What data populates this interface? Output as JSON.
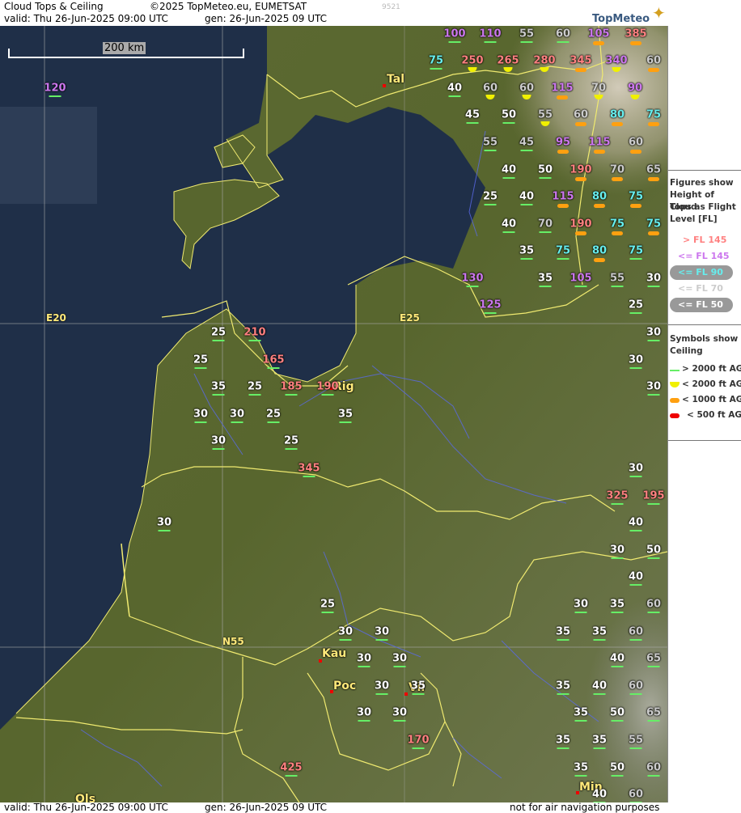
{
  "header": {
    "title": "Cloud Tops & Ceiling",
    "copyright": "©2025 TopMeteo.eu, EUMETSAT",
    "code": "9521",
    "valid": "valid:  Thu  26-Jun-2025  09:00 UTC",
    "gen": "gen: 26-Jun-2025 09 UTC",
    "logo": "TopMeteo"
  },
  "footer": {
    "valid": "valid:  Thu  26-Jun-2025  09:00 UTC",
    "gen": "gen: 26-Jun-2025 09 UTC",
    "disclaimer": "not for air navigation purposes"
  },
  "map": {
    "scale_label": "200 km",
    "coords": {
      "e20": "E20",
      "e25": "E25",
      "n55": "N55"
    },
    "cities": [
      "Tal",
      "Rig",
      "Kau",
      "Poc",
      "Vil",
      "Min",
      "Ols"
    ],
    "colors": {
      "pink": "#ff8080",
      "violet": "#cc77ee",
      "cyan": "#66eeee",
      "grey": "#cccccc",
      "white": "#ffffff",
      "sym_green": "#66ee66",
      "sym_yellow": "#f0f000",
      "sym_orange": "#ffa010",
      "sym_red": "#ee0000"
    },
    "cloud_labels": [
      [
        "100",
        "violet",
        "green"
      ],
      [
        "110",
        "violet",
        "green"
      ],
      [
        "55",
        "grey",
        "green"
      ],
      [
        "60",
        "grey",
        "green"
      ],
      [
        "105",
        "violet",
        "orange"
      ],
      [
        "385",
        "pink",
        "orange"
      ],
      [
        "120",
        "violet",
        "green"
      ],
      [
        "75",
        "cyan",
        "green"
      ],
      [
        "250",
        "pink",
        "yellow"
      ],
      [
        "265",
        "pink",
        "yellow"
      ],
      [
        "280",
        "pink",
        "yellow"
      ],
      [
        "345",
        "pink",
        "orange"
      ],
      [
        "340",
        "violet",
        "yellow"
      ],
      [
        "60",
        "grey",
        "orange"
      ],
      [
        "40",
        "white",
        "green"
      ],
      [
        "60",
        "grey",
        "yellow"
      ],
      [
        "60",
        "grey",
        "yellow"
      ],
      [
        "115",
        "violet",
        "orange"
      ],
      [
        "70",
        "grey",
        "yellow"
      ],
      [
        "90",
        "violet",
        "yellow"
      ],
      [
        "45",
        "white",
        "green"
      ],
      [
        "50",
        "white",
        "green"
      ],
      [
        "55",
        "grey",
        "yellow"
      ],
      [
        "60",
        "grey",
        "orange"
      ],
      [
        "80",
        "cyan",
        "orange"
      ],
      [
        "75",
        "cyan",
        "orange"
      ],
      [
        "55",
        "grey",
        "green"
      ],
      [
        "45",
        "grey",
        "green"
      ],
      [
        "95",
        "violet",
        "orange"
      ],
      [
        "115",
        "violet",
        "orange"
      ],
      [
        "60",
        "grey",
        "orange"
      ],
      [
        "40",
        "white",
        "green"
      ],
      [
        "50",
        "white",
        "green"
      ],
      [
        "190",
        "pink",
        "orange"
      ],
      [
        "70",
        "grey",
        "orange"
      ],
      [
        "65",
        "grey",
        "orange"
      ],
      [
        "25",
        "white",
        "green"
      ],
      [
        "40",
        "white",
        "green"
      ],
      [
        "115",
        "violet",
        "orange"
      ],
      [
        "80",
        "cyan",
        "orange"
      ],
      [
        "75",
        "cyan",
        "orange"
      ],
      [
        "40",
        "white",
        "green"
      ],
      [
        "70",
        "grey",
        "green"
      ],
      [
        "190",
        "pink",
        "orange"
      ],
      [
        "75",
        "cyan",
        "orange"
      ],
      [
        "75",
        "cyan",
        "orange"
      ],
      [
        "35",
        "white",
        "green"
      ],
      [
        "75",
        "cyan",
        "green"
      ],
      [
        "80",
        "cyan",
        "orange"
      ],
      [
        "75",
        "cyan",
        "green"
      ],
      [
        "130",
        "violet",
        "green"
      ],
      [
        "35",
        "white",
        "green"
      ],
      [
        "105",
        "violet",
        "green"
      ],
      [
        "55",
        "grey",
        "green"
      ],
      [
        "30",
        "white",
        "green"
      ],
      [
        "125",
        "violet",
        "green"
      ],
      [
        "25",
        "white",
        "green"
      ],
      [
        "25",
        "white",
        "green"
      ],
      [
        "210",
        "pink",
        "green"
      ],
      [
        "30",
        "white",
        "green"
      ],
      [
        "165",
        "pink",
        "green"
      ],
      [
        "25",
        "white",
        "green"
      ],
      [
        "30",
        "white",
        "green"
      ],
      [
        "35",
        "white",
        "green"
      ],
      [
        "25",
        "white",
        "green"
      ],
      [
        "185",
        "pink",
        "green"
      ],
      [
        "190",
        "pink",
        "green"
      ],
      [
        "30",
        "white",
        "green"
      ],
      [
        "30",
        "white",
        "green"
      ],
      [
        "30",
        "white",
        "green"
      ],
      [
        "25",
        "white",
        "green"
      ],
      [
        "35",
        "white",
        "green"
      ],
      [
        "30",
        "white",
        "green"
      ],
      [
        "25",
        "white",
        "green"
      ],
      [
        "345",
        "pink",
        "green"
      ],
      [
        "30",
        "white",
        "green"
      ],
      [
        "325",
        "pink",
        "green"
      ],
      [
        "195",
        "pink",
        "green"
      ],
      [
        "30",
        "white",
        "green"
      ],
      [
        "40",
        "white",
        "green"
      ],
      [
        "30",
        "white",
        "green"
      ],
      [
        "50",
        "white",
        "green"
      ],
      [
        "40",
        "white",
        "green"
      ],
      [
        "25",
        "white",
        "green"
      ],
      [
        "30",
        "white",
        "green"
      ],
      [
        "35",
        "white",
        "green"
      ],
      [
        "60",
        "grey",
        "green"
      ],
      [
        "30",
        "white",
        "green"
      ],
      [
        "30",
        "white",
        "green"
      ],
      [
        "35",
        "white",
        "green"
      ],
      [
        "35",
        "white",
        "green"
      ],
      [
        "60",
        "grey",
        "green"
      ],
      [
        "30",
        "white",
        "green"
      ],
      [
        "30",
        "white",
        "green"
      ],
      [
        "40",
        "white",
        "green"
      ],
      [
        "65",
        "grey",
        "green"
      ],
      [
        "30",
        "white",
        "green"
      ],
      [
        "35",
        "white",
        "green"
      ],
      [
        "35",
        "white",
        "green"
      ],
      [
        "40",
        "white",
        "green"
      ],
      [
        "60",
        "grey",
        "green"
      ],
      [
        "30",
        "white",
        "green"
      ],
      [
        "30",
        "white",
        "green"
      ],
      [
        "35",
        "white",
        "green"
      ],
      [
        "50",
        "white",
        "green"
      ],
      [
        "65",
        "grey",
        "green"
      ],
      [
        "170",
        "pink",
        "green"
      ],
      [
        "35",
        "white",
        "green"
      ],
      [
        "35",
        "white",
        "green"
      ],
      [
        "55",
        "grey",
        "green"
      ],
      [
        "425",
        "pink",
        "green"
      ],
      [
        "35",
        "white",
        "green"
      ],
      [
        "50",
        "white",
        "green"
      ],
      [
        "60",
        "grey",
        "green"
      ],
      [
        "40",
        "white",
        "green"
      ],
      [
        "60",
        "grey",
        "green"
      ]
    ]
  },
  "legend": {
    "title": [
      "Figures show",
      "Height of Cloud",
      "Tops as Flight",
      "Level  [FL]"
    ],
    "levels": [
      "> FL 145",
      "<= FL 145",
      "<= FL 90",
      "<= FL 70",
      "<= FL 50"
    ],
    "symbols_title": [
      "Symbols show",
      "Ceiling"
    ],
    "symbols": [
      "> 2000 ft AGL",
      "< 2000 ft AGL",
      "< 1000 ft AGL",
      "< 500 ft AGL"
    ]
  }
}
